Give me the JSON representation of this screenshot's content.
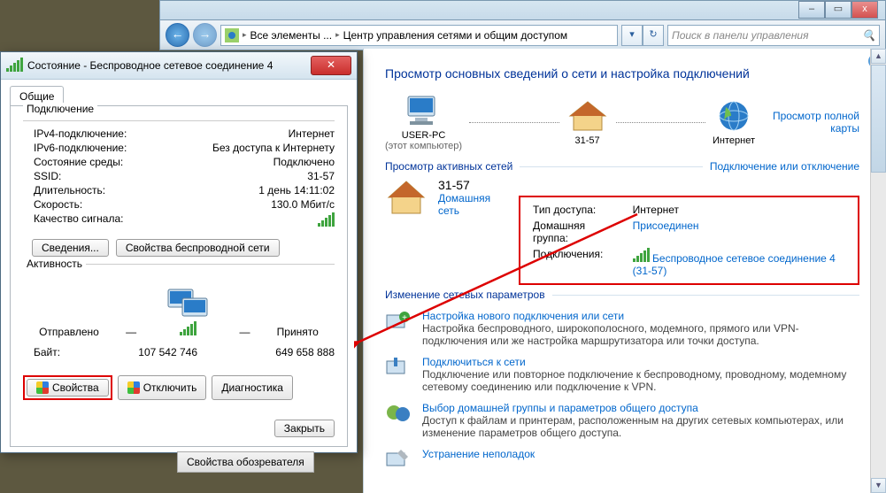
{
  "window_controls": {
    "min": "–",
    "max": "▭",
    "close": "x"
  },
  "toolbar": {
    "crumb1": "Все элементы ...",
    "crumb2": "Центр управления сетями и общим доступом",
    "search_placeholder": "Поиск в панели управления"
  },
  "main": {
    "heading": "Просмотр основных сведений о сети и настройка подключений",
    "map": {
      "pc_name": "USER-PC",
      "pc_sub": "(этот компьютер)",
      "middle": "31-57",
      "internet": "Интернет",
      "fullmap": "Просмотр полной карты"
    },
    "active_nets_head": "Просмотр активных сетей",
    "toggle_link": "Подключение или отключение",
    "net": {
      "name": "31-57",
      "type": "Домашняя сеть",
      "access_k": "Тип доступа:",
      "access_v": "Интернет",
      "homegroup_k": "Домашняя группа:",
      "homegroup_v": "Присоединен",
      "conn_k": "Подключения:",
      "conn_v": "Беспроводное сетевое соединение 4 (31-57)"
    },
    "change_head": "Изменение сетевых параметров",
    "items": [
      {
        "t": "Настройка нового подключения или сети",
        "d": "Настройка беспроводного, широкополосного, модемного, прямого или VPN-подключения или же настройка маршрутизатора или точки доступа."
      },
      {
        "t": "Подключиться к сети",
        "d": "Подключение или повторное подключение к беспроводному, проводному, модемному сетевому соединению или подключение к VPN."
      },
      {
        "t": "Выбор домашней группы и параметров общего доступа",
        "d": "Доступ к файлам и принтерам, расположенным на других сетевых компьютерах, или изменение параметров общего доступа."
      },
      {
        "t": "Устранение неполадок",
        "d": ""
      }
    ]
  },
  "dialog": {
    "title": "Состояние - Беспроводное сетевое соединение 4",
    "tab": "Общие",
    "sect_conn": "Подключение",
    "rows": [
      {
        "k": "IPv4-подключение:",
        "v": "Интернет"
      },
      {
        "k": "IPv6-подключение:",
        "v": "Без доступа к Интернету"
      },
      {
        "k": "Состояние среды:",
        "v": "Подключено"
      },
      {
        "k": "SSID:",
        "v": "31-57"
      },
      {
        "k": "Длительность:",
        "v": "1 день 14:11:02"
      },
      {
        "k": "Скорость:",
        "v": "130.0 Мбит/c"
      },
      {
        "k": "Качество сигнала:",
        "v": ""
      }
    ],
    "btn_details": "Сведения...",
    "btn_wifiprops": "Свойства беспроводной сети",
    "sect_activity": "Активность",
    "sent": "Отправлено",
    "recv": "Принято",
    "bytes_label": "Байт:",
    "bytes_sent": "107 542 746",
    "bytes_recv": "649 658 888",
    "btn_props": "Свойства",
    "btn_disable": "Отключить",
    "btn_diag": "Диагностика",
    "btn_close": "Закрыть"
  },
  "stray": "Свойства обозревателя"
}
